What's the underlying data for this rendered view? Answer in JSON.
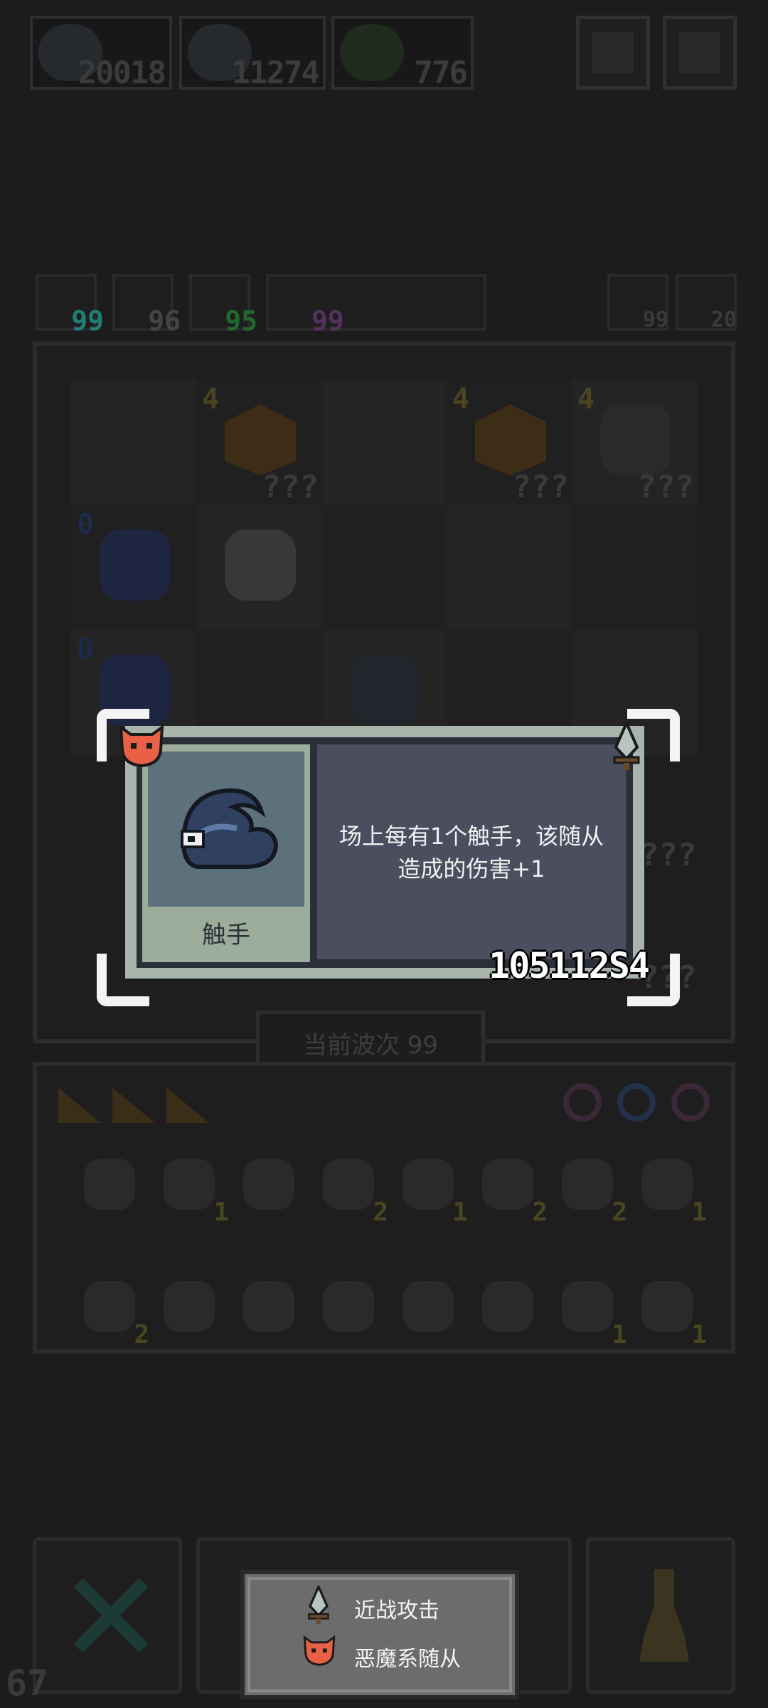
{
  "resources": [
    {
      "name": "tentacle-token",
      "value": "20018"
    },
    {
      "name": "wizard-hat-token",
      "value": "11274"
    },
    {
      "name": "green-orb-token",
      "value": "776"
    }
  ],
  "stats": [
    {
      "icon": "cyan-shield-icon",
      "value": "99",
      "color": "#1f7f76"
    },
    {
      "icon": "sword-x-icon",
      "value": "96",
      "color": "#444"
    },
    {
      "icon": "green-blob-icon",
      "value": "95",
      "color": "#1f6a2c"
    },
    {
      "icon": "lightning-icon",
      "value": "99",
      "color": "#55315e"
    }
  ],
  "right_stats": [
    {
      "icon": "refresh-icon",
      "value": "99"
    },
    {
      "icon": "key-icon",
      "value": "20"
    }
  ],
  "board": {
    "cells": [
      {
        "tier": "",
        "q": "",
        "art": ""
      },
      {
        "tier": "4",
        "q": "???",
        "art": "crate"
      },
      {
        "tier": "",
        "q": "",
        "art": ""
      },
      {
        "tier": "4",
        "q": "???",
        "art": "crate"
      },
      {
        "tier": "4",
        "q": "???",
        "art": "hooded"
      },
      {
        "tier": "0",
        "q": "",
        "art": "robot"
      },
      {
        "tier": "",
        "q": "",
        "art": "skeleton"
      },
      {
        "tier": "",
        "q": "",
        "art": ""
      },
      {
        "tier": "",
        "q": "",
        "art": ""
      },
      {
        "tier": "",
        "q": "",
        "art": ""
      },
      {
        "tier": "0",
        "q": "",
        "art": "robot2"
      },
      {
        "tier": "",
        "q": "",
        "art": ""
      },
      {
        "tier": "",
        "q": "",
        "art": "tentacle"
      },
      {
        "tier": "",
        "q": "",
        "art": ""
      },
      {
        "tier": "",
        "q": "",
        "art": ""
      }
    ],
    "right_q": [
      "???",
      "???"
    ]
  },
  "wave": {
    "label": "当前波次 99"
  },
  "inventory": {
    "top_icons": [
      "wedge-icon",
      "wedge-icon",
      "wedge-icon"
    ],
    "ring_icons": [
      "ring-icon",
      "ring-icon",
      "ring-icon"
    ],
    "items": [
      {
        "icon": "slime-icon",
        "count": ""
      },
      {
        "icon": "bone-icon",
        "count": "1"
      },
      {
        "icon": "shield-icon",
        "count": ""
      },
      {
        "icon": "scroll-icon",
        "count": "2"
      },
      {
        "icon": "boot-icon",
        "count": "1"
      },
      {
        "icon": "orb-icon",
        "count": "2"
      },
      {
        "icon": "hourglass-icon",
        "count": "2"
      },
      {
        "icon": "horn-icon",
        "count": "1"
      },
      {
        "icon": "demon-mask-icon",
        "count": "2"
      },
      {
        "icon": "swirl-icon",
        "count": ""
      },
      {
        "icon": "arrow-icon",
        "count": ""
      },
      {
        "icon": "claw-icon",
        "count": ""
      },
      {
        "icon": "green-arrow-icon",
        "count": ""
      },
      {
        "icon": "teeth-frame-icon",
        "count": ""
      },
      {
        "icon": "potion-icon",
        "count": "1"
      },
      {
        "icon": "axe-icon",
        "count": "1"
      }
    ]
  },
  "dialog": {
    "name": "触手",
    "description_line1": "场上每有1个触手，该随从",
    "description_line2": "造成的伤害+1",
    "id": "105112S4",
    "badge_left": "demon-face-icon",
    "badge_right": "dagger-icon",
    "accent": "#e86045"
  },
  "tooltip": {
    "rows": [
      {
        "icon": "dagger-icon",
        "label": "近战攻击"
      },
      {
        "icon": "demon-face-icon",
        "label": "恶魔系随从"
      }
    ]
  },
  "fps": "67"
}
